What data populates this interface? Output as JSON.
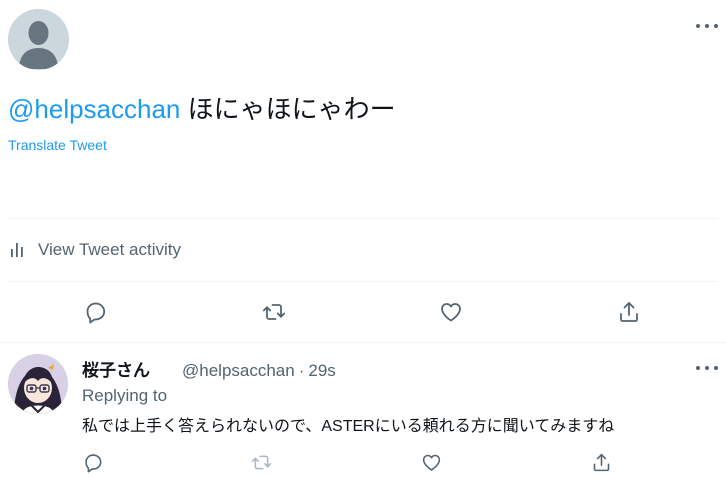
{
  "main_tweet": {
    "mention": "@helpsacchan",
    "text": " ほにゃほにゃわー",
    "translate_label": "Translate Tweet",
    "activity_label": "View Tweet activity",
    "avatar": "default-avatar-icon",
    "more": "more-options-icon"
  },
  "actions": {
    "reply_icon": "reply-icon",
    "retweet_icon": "retweet-icon",
    "like_icon": "like-icon",
    "share_icon": "share-icon"
  },
  "reply": {
    "name": "桜子さん",
    "handle": "@helpsacchan",
    "separator": "·",
    "time": "29s",
    "replying_to": "Replying to",
    "text": "私では上手く答えられないので、ASTERにいる頼れる方に聞いてみますね"
  },
  "colors": {
    "accent": "#1d9bf0",
    "secondary_text": "#536471",
    "divider": "#eff3f4"
  }
}
